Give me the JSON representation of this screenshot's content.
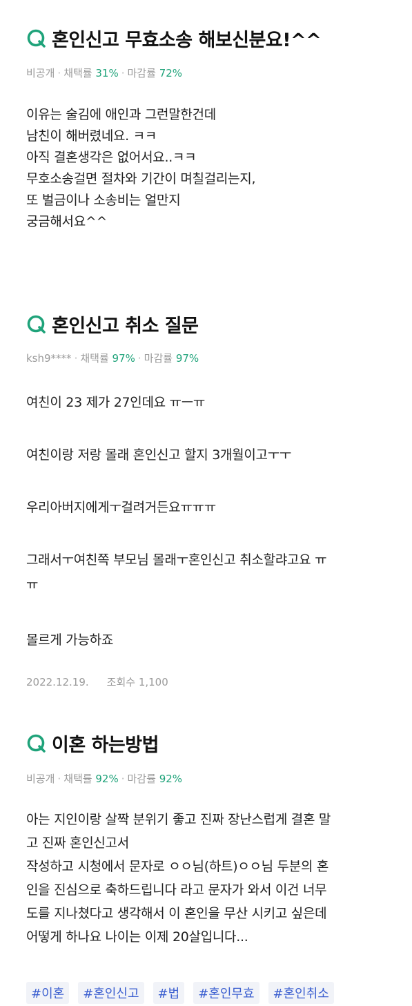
{
  "posts": [
    {
      "title": "혼인신고 무효소송 해보신분요!^^",
      "author": "비공개",
      "adopt_label": "채택률",
      "adopt_rate": "31%",
      "close_label": "마감률",
      "close_rate": "72%",
      "lines": [
        "이유는 술김에 애인과 그런말한건데",
        "남친이 해버렸네요. ㅋㅋ",
        "아직 결혼생각은 없어서요..ㅋㅋ",
        "무호소송걸면 절차와 기간이 며칠걸리는지,",
        "또 벌금이나 소송비는 얼만지",
        "궁금해서요^^"
      ]
    },
    {
      "title": "혼인신고 취소 질문",
      "author": "ksh9****",
      "adopt_label": "채택률",
      "adopt_rate": "97%",
      "close_label": "마감률",
      "close_rate": "97%",
      "paragraphs": [
        "여친이 23 제가 27인데요 ㅠㅡㅠ",
        "여친이랑 저랑 몰래 혼인신고 할지 3개월이고ㅜㅜ",
        "우리아버지에게ㅜ걸려거든요ㅠㅠㅠ",
        "그래서ㅜ여친쪽 부모님 몰래ㅜ혼인신고 취소할랴고요 ㅠ",
        "ㅠ",
        "몰르게 가능하죠"
      ],
      "date": "2022.12.19.",
      "views": "조회수 1,100"
    },
    {
      "title": "이혼 하는방법",
      "author": "비공개",
      "adopt_label": "채택률",
      "adopt_rate": "92%",
      "close_label": "마감률",
      "close_rate": "92%",
      "lines": [
        "아는 지인이랑 살짝 분위기 좋고 진짜 장난스럽게 결혼 말",
        "고 진짜 혼인신고서",
        "작성하고 시청에서 문자로 ㅇㅇ님(하트)ㅇㅇ님 두분의 혼",
        "인을 진심으로 축하드립니다 라고 문자가 와서 이건 너무",
        "도를 지나쳤다고 생각해서 이 혼인을 무산 시키고 싶은데",
        "어떻게 하나요 나이는 이제 20살입니다..."
      ],
      "tags": [
        "#이혼",
        "#혼인신고",
        "#법",
        "#혼인무효",
        "#혼인취소"
      ]
    }
  ],
  "colors": {
    "accent_green": "#1fa37a",
    "tag_blue": "#3b5fd0",
    "meta_gray": "#9a9a9a"
  },
  "icons": {
    "question": "q-icon"
  }
}
